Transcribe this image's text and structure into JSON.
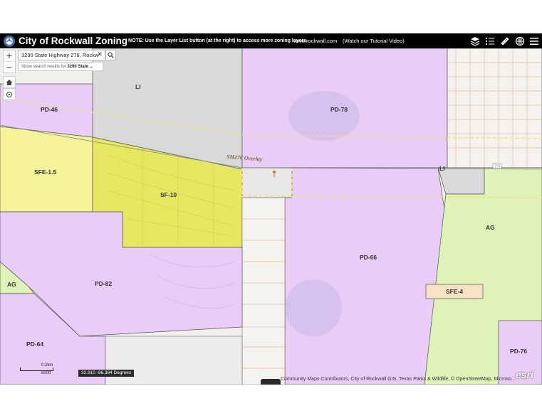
{
  "header": {
    "title": "City of Rockwall Zoning",
    "note": "NOTE: Use the Layer List button (at the right) to access more zoning layers.",
    "website": "www.rockwall.com",
    "video_link": "(Watch our Tutorial Video)",
    "icons": [
      "layers-icon",
      "layer-list-icon",
      "measure-icon",
      "basemap-gallery-icon",
      "menu-icon"
    ]
  },
  "search": {
    "value": "3290 State Highway 276, Rockw",
    "suggestion_prefix": "Show search results for ",
    "suggestion_term": "3290 State ..."
  },
  "zones": {
    "pd46": "PD-46",
    "pd78": "PD-78",
    "li1": "LI",
    "sfe15": "SFE-1.5",
    "sf10": "SF-10",
    "li2": "LI",
    "pd66": "PD-66",
    "ag1": "AG",
    "pd82": "PD-82",
    "ag2": "AG",
    "sfe4": "SFE-4",
    "pd64": "PD-64",
    "pd76": "PD-76"
  },
  "overlay_label": "SH276 Overlay",
  "road_shield": "276",
  "coordinates": "32.910 -96.384 Degrees",
  "scale": {
    "top": "0.2km",
    "bottom": "600ft"
  },
  "attribution": "Community Maps Contributors, City of Rockwall GIS, Texas Parks & Wildlife, © OpenStreetMap, Microso...",
  "esri": "esri",
  "colors": {
    "pd": "#e9cdf6",
    "li": "#d9d9d9",
    "sfe": "#f5f39a",
    "sf10": "#e6e861",
    "ag": "#dff2b8",
    "sfe4": "#f7e3c3",
    "header": "#000000"
  }
}
